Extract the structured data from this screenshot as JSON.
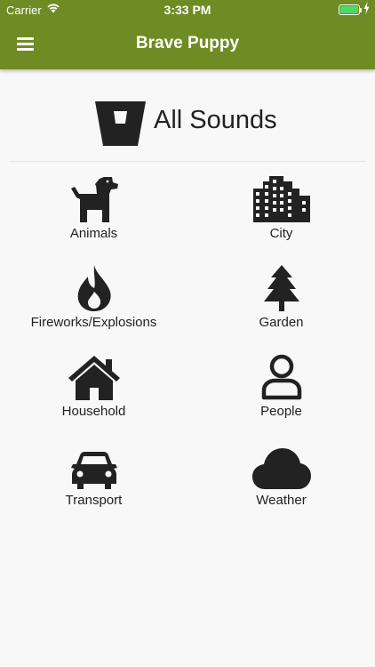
{
  "status_bar": {
    "carrier": "Carrier",
    "time": "3:33 PM",
    "battery_level": 1.0
  },
  "app_bar": {
    "title": "Brave Puppy",
    "menu_icon": "hamburger-menu-icon"
  },
  "section": {
    "title": "All Sounds",
    "icon": "bucket-icon"
  },
  "categories": [
    {
      "label": "Animals",
      "icon": "dog-icon"
    },
    {
      "label": "City",
      "icon": "city-buildings-icon"
    },
    {
      "label": "Fireworks/Explosions",
      "icon": "fire-icon"
    },
    {
      "label": "Garden",
      "icon": "tree-icon"
    },
    {
      "label": "Household",
      "icon": "house-icon"
    },
    {
      "label": "People",
      "icon": "person-icon"
    },
    {
      "label": "Transport",
      "icon": "car-icon"
    },
    {
      "label": "Weather",
      "icon": "cloud-icon"
    }
  ],
  "colors": {
    "accent": "#6f8c24",
    "icon": "#222222",
    "background": "#f8f8f8"
  }
}
